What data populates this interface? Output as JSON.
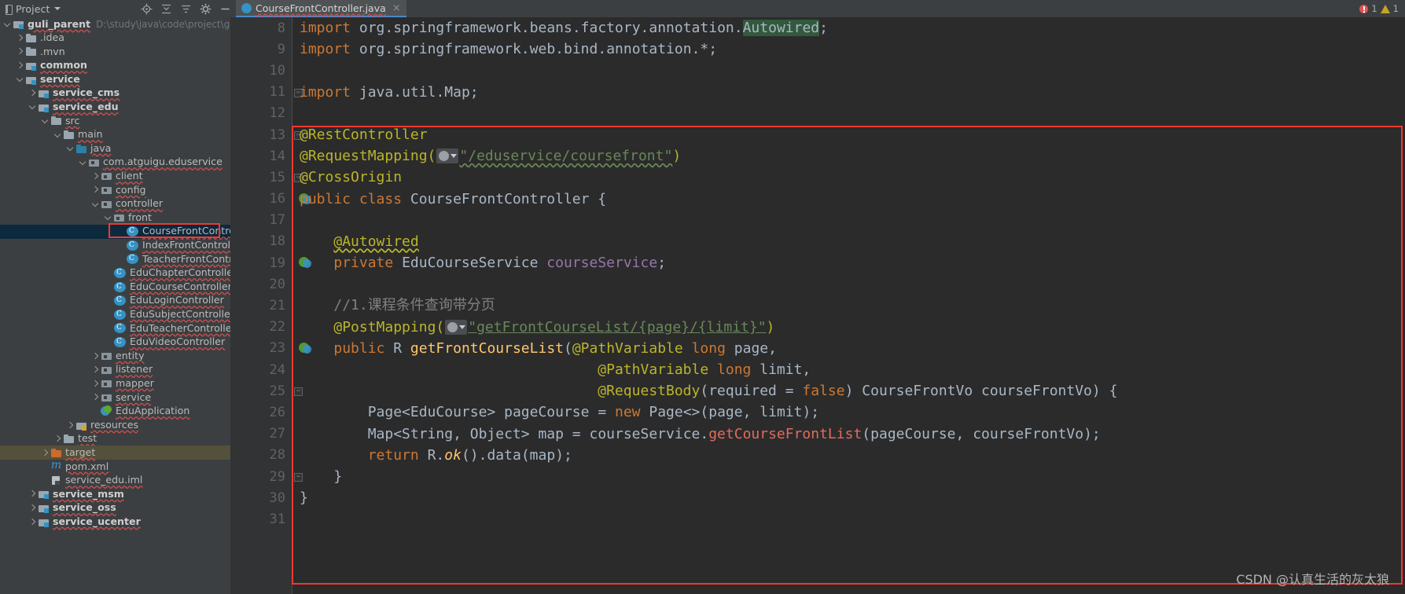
{
  "window": {
    "project_tool_title": "Project",
    "tool_icons": [
      "locate-icon",
      "collapse-all-icon",
      "expand-settings-icon",
      "gear-icon",
      "hide-icon"
    ]
  },
  "inspections": {
    "error_count": "1",
    "warning_count": "1"
  },
  "editor_tab": {
    "label": "CourseFrontController.java",
    "icon": "java-class-icon",
    "close": "×"
  },
  "sidebar": {
    "items": [
      {
        "label": "guli_parent",
        "path": "D:\\study\\java\\code\\project\\guli_parent",
        "icon": "module-icon",
        "arrow": "down",
        "indent": 0,
        "bold": true,
        "wavy": true,
        "state": "normal"
      },
      {
        "label": ".idea",
        "icon": "folder-icon",
        "arrow": "right",
        "indent": 1,
        "bold": false,
        "state": "normal"
      },
      {
        "label": ".mvn",
        "icon": "folder-icon",
        "arrow": "right",
        "indent": 1,
        "bold": false,
        "state": "normal"
      },
      {
        "label": "common",
        "icon": "module-icon",
        "arrow": "right",
        "indent": 1,
        "bold": true,
        "wavy": true,
        "state": "normal"
      },
      {
        "label": "service",
        "icon": "module-icon",
        "arrow": "down",
        "indent": 1,
        "bold": true,
        "wavy": true,
        "state": "normal"
      },
      {
        "label": "service_cms",
        "icon": "module-icon",
        "arrow": "right",
        "indent": 2,
        "bold": true,
        "wavy": true,
        "state": "normal"
      },
      {
        "label": "service_edu",
        "icon": "module-icon",
        "arrow": "down",
        "indent": 2,
        "bold": true,
        "wavy": true,
        "state": "normal"
      },
      {
        "label": "src",
        "icon": "folder-icon",
        "arrow": "down",
        "indent": 3,
        "bold": false,
        "wavy": true,
        "state": "normal"
      },
      {
        "label": "main",
        "icon": "folder-icon",
        "arrow": "down",
        "indent": 4,
        "bold": false,
        "wavy": true,
        "state": "normal"
      },
      {
        "label": "java",
        "icon": "source-folder-icon",
        "arrow": "down",
        "indent": 5,
        "bold": false,
        "wavy": true,
        "state": "normal"
      },
      {
        "label": "com.atguigu.eduservice",
        "icon": "package-icon",
        "arrow": "down",
        "indent": 6,
        "bold": false,
        "wavy": true,
        "state": "normal"
      },
      {
        "label": "client",
        "icon": "package-icon",
        "arrow": "right",
        "indent": 7,
        "bold": false,
        "wavy": true,
        "state": "normal"
      },
      {
        "label": "config",
        "icon": "package-icon",
        "arrow": "right",
        "indent": 7,
        "bold": false,
        "wavy": true,
        "state": "normal"
      },
      {
        "label": "controller",
        "icon": "package-icon",
        "arrow": "down",
        "indent": 7,
        "bold": false,
        "wavy": true,
        "state": "normal"
      },
      {
        "label": "front",
        "icon": "package-icon",
        "arrow": "down",
        "indent": 8,
        "bold": false,
        "wavy": true,
        "state": "normal"
      },
      {
        "label": "CourseFrontController",
        "icon": "java-class-icon",
        "arrow": "none",
        "indent": 9,
        "bold": false,
        "wavy": true,
        "state": "selected"
      },
      {
        "label": "IndexFrontController",
        "icon": "java-class-icon",
        "arrow": "none",
        "indent": 9,
        "bold": false,
        "wavy": true,
        "state": "normal"
      },
      {
        "label": "TeacherFrontController",
        "icon": "java-class-icon",
        "arrow": "none",
        "indent": 9,
        "bold": false,
        "wavy": true,
        "state": "normal"
      },
      {
        "label": "EduChapterController",
        "icon": "java-class-icon",
        "arrow": "none",
        "indent": 8,
        "bold": false,
        "wavy": true,
        "state": "normal"
      },
      {
        "label": "EduCourseController",
        "icon": "java-class-icon",
        "arrow": "none",
        "indent": 8,
        "bold": false,
        "wavy": true,
        "state": "normal"
      },
      {
        "label": "EduLoginController",
        "icon": "java-class-icon",
        "arrow": "none",
        "indent": 8,
        "bold": false,
        "wavy": true,
        "state": "normal"
      },
      {
        "label": "EduSubjectController",
        "icon": "java-class-icon",
        "arrow": "none",
        "indent": 8,
        "bold": false,
        "wavy": true,
        "state": "normal"
      },
      {
        "label": "EduTeacherController",
        "icon": "java-class-icon",
        "arrow": "none",
        "indent": 8,
        "bold": false,
        "wavy": true,
        "state": "normal"
      },
      {
        "label": "EduVideoController",
        "icon": "java-class-icon",
        "arrow": "none",
        "indent": 8,
        "bold": false,
        "wavy": true,
        "state": "normal"
      },
      {
        "label": "entity",
        "icon": "package-icon",
        "arrow": "right",
        "indent": 7,
        "bold": false,
        "wavy": true,
        "state": "normal"
      },
      {
        "label": "listener",
        "icon": "package-icon",
        "arrow": "right",
        "indent": 7,
        "bold": false,
        "wavy": true,
        "state": "normal"
      },
      {
        "label": "mapper",
        "icon": "package-icon",
        "arrow": "right",
        "indent": 7,
        "bold": false,
        "wavy": true,
        "state": "normal"
      },
      {
        "label": "service",
        "icon": "package-icon",
        "arrow": "right",
        "indent": 7,
        "bold": false,
        "wavy": true,
        "state": "normal"
      },
      {
        "label": "EduApplication",
        "icon": "spring-boot-icon",
        "arrow": "none",
        "indent": 7,
        "bold": false,
        "wavy": true,
        "state": "normal"
      },
      {
        "label": "resources",
        "icon": "resources-folder-icon",
        "arrow": "right",
        "indent": 5,
        "bold": false,
        "wavy": true,
        "state": "normal"
      },
      {
        "label": "test",
        "icon": "folder-icon",
        "arrow": "right",
        "indent": 4,
        "bold": false,
        "wavy": true,
        "state": "normal"
      },
      {
        "label": "target",
        "icon": "target-folder-icon",
        "arrow": "right",
        "indent": 3,
        "bold": false,
        "wavy": true,
        "state": "highlighted"
      },
      {
        "label": "pom.xml",
        "icon": "maven-icon",
        "arrow": "none",
        "indent": 3,
        "bold": false,
        "wavy": true,
        "state": "normal"
      },
      {
        "label": "service_edu.iml",
        "icon": "iml-file-icon",
        "arrow": "none",
        "indent": 3,
        "bold": false,
        "wavy": true,
        "state": "normal"
      },
      {
        "label": "service_msm",
        "icon": "module-icon",
        "arrow": "right",
        "indent": 2,
        "bold": true,
        "wavy": true,
        "state": "normal"
      },
      {
        "label": "service_oss",
        "icon": "module-icon",
        "arrow": "right",
        "indent": 2,
        "bold": true,
        "wavy": true,
        "state": "normal"
      },
      {
        "label": "service_ucenter",
        "icon": "module-icon",
        "arrow": "right",
        "indent": 2,
        "bold": true,
        "wavy": true,
        "state": "normal"
      }
    ]
  },
  "editor": {
    "first_line_number": 8,
    "lines": [
      {
        "n": 8,
        "gutter_marker": "none"
      },
      {
        "n": 9,
        "gutter_marker": "none"
      },
      {
        "n": 10,
        "gutter_marker": "none"
      },
      {
        "n": 11,
        "gutter_marker": "fold"
      },
      {
        "n": 12,
        "gutter_marker": "none"
      },
      {
        "n": 13,
        "gutter_marker": "fold"
      },
      {
        "n": 14,
        "gutter_marker": "none"
      },
      {
        "n": 15,
        "gutter_marker": "fold"
      },
      {
        "n": 16,
        "gutter_marker": "spring-bean"
      },
      {
        "n": 17,
        "gutter_marker": "none"
      },
      {
        "n": 18,
        "gutter_marker": "none"
      },
      {
        "n": 19,
        "gutter_marker": "spring-bean"
      },
      {
        "n": 20,
        "gutter_marker": "none"
      },
      {
        "n": 21,
        "gutter_marker": "none"
      },
      {
        "n": 22,
        "gutter_marker": "none"
      },
      {
        "n": 23,
        "gutter_marker": "spring-bean"
      },
      {
        "n": 24,
        "gutter_marker": "none"
      },
      {
        "n": 25,
        "gutter_marker": "fold"
      },
      {
        "n": 26,
        "gutter_marker": "none"
      },
      {
        "n": 27,
        "gutter_marker": "none"
      },
      {
        "n": 28,
        "gutter_marker": "none"
      },
      {
        "n": 29,
        "gutter_marker": "fold"
      },
      {
        "n": 30,
        "gutter_marker": "none"
      },
      {
        "n": 31,
        "gutter_marker": "none"
      }
    ],
    "code": {
      "l8": "import org.springframework.beans.factory.annotation.Autowired;",
      "l9": "import org.springframework.web.bind.annotation.*;",
      "l11": "import java.util.Map;",
      "l13": "@RestController",
      "l14_a": "@RequestMapping(",
      "l14_str": "\"/eduservice/coursefront\"",
      "l14_b": ")",
      "l15": "@CrossOrigin",
      "l16": "public class CourseFrontController {",
      "l18": "@Autowired",
      "l19": "private EduCourseService courseService;",
      "l21": "//1.课程条件查询带分页",
      "l22_a": "@PostMapping(",
      "l22_str": "\"getFrontCourseList/{page}/{limit}\"",
      "l22_b": ")",
      "l23": "public R getFrontCourseList(@PathVariable long page,",
      "l24": "@PathVariable long limit,",
      "l25": "@RequestBody(required = false) CourseFrontVo courseFrontVo) {",
      "l26": "Page<EduCourse> pageCourse = new Page<>(page, limit);",
      "l27": "Map<String, Object> map = courseService.getCourseFrontList(pageCourse, courseFrontVo);",
      "l28": "return R.ok().data(map);",
      "l29": "}",
      "l30": "}"
    }
  },
  "watermark": {
    "text": "CSDN @认真生活的灰太狼"
  },
  "colors": {
    "accent_blue": "#3592c4",
    "annotation_red": "#f03a2e",
    "keyword_orange": "#cc7832",
    "annotation_yellow": "#bbb529",
    "string_green": "#6a8759",
    "editor_bg": "#2b2b2b",
    "ide_bg": "#3c3f41",
    "selection_blue": "#0d293e",
    "highlight_olive": "#53503b"
  }
}
